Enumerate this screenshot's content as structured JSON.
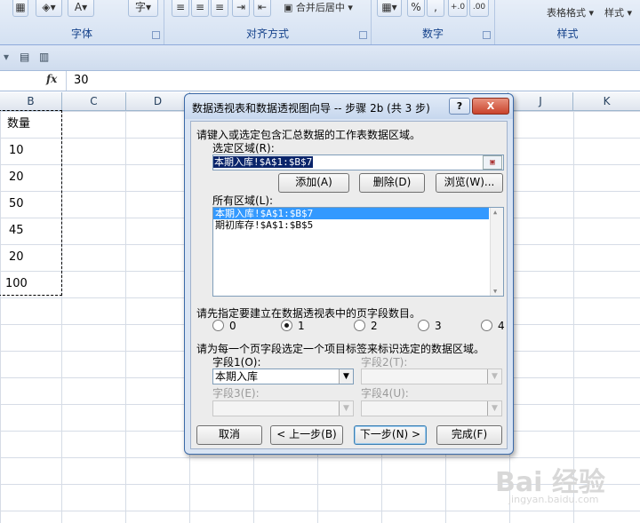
{
  "ribbon": {
    "groups": [
      {
        "label": "字体"
      },
      {
        "label": "对齐方式"
      },
      {
        "label": "数字"
      },
      {
        "label": "样式"
      }
    ],
    "merge_center": "合并后居中",
    "percent": "%",
    "comma": ",",
    "table_format": "表格格式",
    "cell_style": "样式"
  },
  "formula_bar": {
    "fx": "fx",
    "value": "30"
  },
  "columns": [
    "B",
    "C",
    "D",
    "J",
    "K"
  ],
  "cells": {
    "header": "数量",
    "values": [
      "10",
      "20",
      "50",
      "45",
      "20",
      "100"
    ]
  },
  "dialog": {
    "title": "数据透视表和数据透视图向导 -- 步骤 2b (共 3 步)",
    "help_label": "?",
    "close_label": "X",
    "instruction": "请键入或选定包含汇总数据的工作表数据区域。",
    "range_label": "选定区域(R):",
    "range_value": "本期入库!$A$1:$B$7",
    "add_button": "添加(A)",
    "delete_button": "删除(D)",
    "browse_button": "浏览(W)...",
    "all_ranges_label": "所有区域(L):",
    "ranges": [
      "本期入库!$A$1:$B$7",
      "期初库存!$A$1:$B$5"
    ],
    "page_fields_prompt": "请先指定要建立在数据透视表中的页字段数目。",
    "page_field_options": [
      "0",
      "1",
      "2",
      "3",
      "4"
    ],
    "page_field_selected": "1",
    "label_prompt": "请为每一个页字段选定一个项目标签来标识选定的数据区域。",
    "field1_label": "字段1(O):",
    "field1_value": "本期入库",
    "field2_label": "字段2(T):",
    "field3_label": "字段3(E):",
    "field4_label": "字段4(U):",
    "cancel_button": "取消",
    "back_button": "< 上一步(B)",
    "next_button": "下一步(N) >",
    "finish_button": "完成(F)"
  },
  "watermark": {
    "brand": "Bai 经验",
    "url": "jingyan.baidu.com"
  }
}
